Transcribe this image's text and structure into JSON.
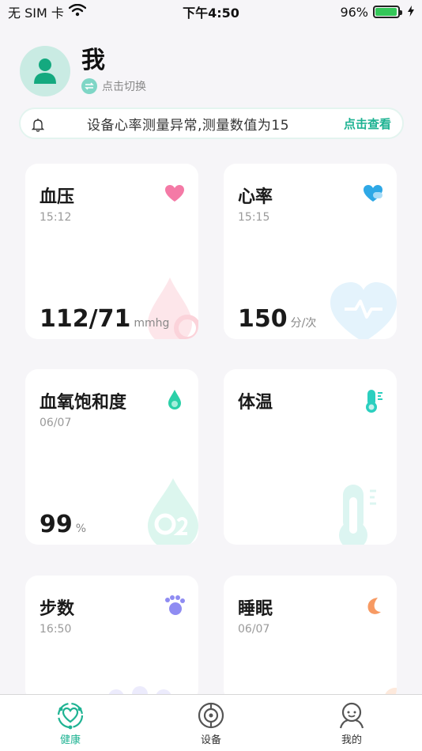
{
  "status_bar": {
    "carrier": "无 SIM 卡",
    "time": "下午4:50",
    "battery": "96%",
    "battery_level": 0.96
  },
  "profile": {
    "name": "我",
    "switch_label": "点击切换"
  },
  "notice": {
    "text": "设备心率测量异常,测量数值为15",
    "link": "点击查看"
  },
  "cards": {
    "blood_pressure": {
      "title": "血压",
      "time": "15:12",
      "value": "112/71",
      "unit": "mmhg"
    },
    "heart_rate": {
      "title": "心率",
      "time": "15:15",
      "value": "150",
      "unit": "分/次"
    },
    "blood_oxygen": {
      "title": "血氧饱和度",
      "time": "06/07",
      "value": "99",
      "unit": "%"
    },
    "temperature": {
      "title": "体温"
    },
    "steps": {
      "title": "步数",
      "time": "16:50"
    },
    "sleep": {
      "title": "睡眠",
      "time": "06/07"
    }
  },
  "tab_bar": {
    "items": [
      {
        "label": "健康",
        "icon": "heart-health-icon"
      },
      {
        "label": "设备",
        "icon": "device-icon"
      },
      {
        "label": "我的",
        "icon": "person-icon"
      }
    ],
    "active_color": "#1fb393"
  },
  "colors": {
    "accent": "#1fb393",
    "background": "#f6f5f8"
  }
}
